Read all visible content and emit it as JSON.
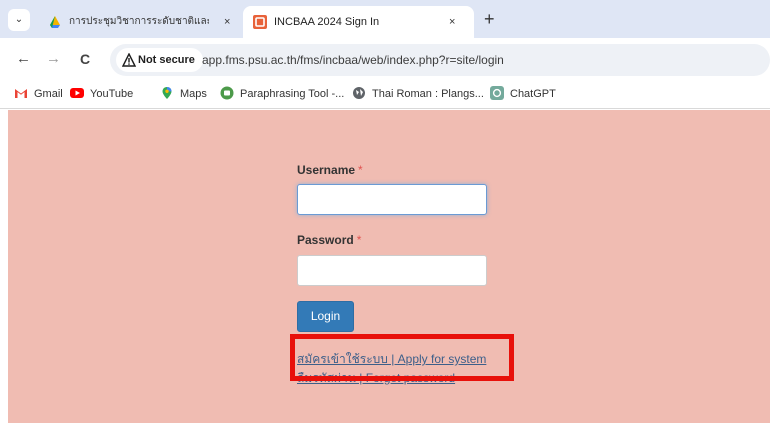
{
  "tabs": [
    {
      "title": "การประชุมวิชาการระดับชาติและนานาชาติ",
      "close": "×"
    },
    {
      "title": "INCBAA 2024 Sign In",
      "close": "×"
    }
  ],
  "tabstrip": {
    "menu_glyph": "⌄",
    "new_tab": "+"
  },
  "toolbar": {
    "back": "←",
    "forward": "→",
    "reload": "C",
    "security_label": "Not secure",
    "url": "app.fms.psu.ac.th/fms/incbaa/web/index.php?r=site/login"
  },
  "bookmarks": [
    {
      "label": "Gmail",
      "icon": "gmail-icon"
    },
    {
      "label": "YouTube",
      "icon": "youtube-icon"
    },
    {
      "label": "Maps",
      "icon": "maps-icon"
    },
    {
      "label": "Paraphrasing Tool -...",
      "icon": "quillbot-icon"
    },
    {
      "label": "Thai Roman : Plangs...",
      "icon": "globe-icon"
    },
    {
      "label": "ChatGPT",
      "icon": "chatgpt-icon"
    }
  ],
  "form": {
    "username_label": "Username",
    "password_label": "Password",
    "required_mark": "*",
    "username_value": "",
    "password_value": "",
    "login_label": "Login",
    "apply_link": "สมัครเข้าใช้ระบบ | Apply for system",
    "forgot_link": "ลืมรหัสผ่าน | Forget password"
  },
  "colors": {
    "page_background": "#f0bcb2",
    "button_primary": "#337ab7",
    "highlight_box": "#e8100a",
    "required_mark": "#e0524f"
  }
}
